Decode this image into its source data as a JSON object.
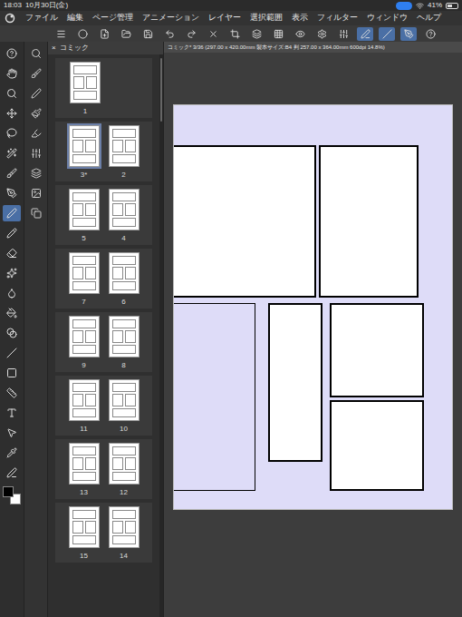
{
  "status_bar": {
    "time": "18:03",
    "date": "10月30日(金)",
    "battery": "41%"
  },
  "menu": {
    "items": [
      "ファイル",
      "編集",
      "ページ管理",
      "アニメーション",
      "レイヤー",
      "選択範囲",
      "表示",
      "フィルター",
      "ウィンドウ",
      "ヘルプ"
    ]
  },
  "command_bar": {
    "toggles": [
      {
        "on": false
      },
      {
        "on": false
      },
      {
        "on": false
      },
      {
        "on": false
      },
      {
        "on": false
      },
      {
        "on": false
      },
      {
        "on": false
      },
      {
        "on": false
      },
      {
        "on": false
      },
      {
        "on": false
      },
      {
        "on": false
      },
      {
        "on": false
      },
      {
        "on": false
      },
      {
        "on": false
      },
      {
        "on": true
      },
      {
        "on": true
      },
      {
        "on": true
      },
      {
        "on": false
      }
    ]
  },
  "tools": [
    {
      "selected": false
    },
    {
      "selected": false
    },
    {
      "selected": false
    },
    {
      "selected": false
    },
    {
      "selected": false
    },
    {
      "selected": false
    },
    {
      "selected": false
    },
    {
      "selected": false
    },
    {
      "selected": true
    },
    {
      "selected": false
    },
    {
      "selected": false
    },
    {
      "selected": false
    },
    {
      "selected": false
    },
    {
      "selected": false
    },
    {
      "selected": false
    },
    {
      "selected": false
    },
    {
      "selected": false
    },
    {
      "selected": false
    },
    {
      "selected": false
    },
    {
      "selected": false
    },
    {
      "selected": false
    },
    {
      "selected": false
    }
  ],
  "sub_tools": [
    {
      "selected": false
    },
    {
      "selected": false
    },
    {
      "selected": false
    },
    {
      "selected": false
    },
    {
      "selected": false
    },
    {
      "selected": false
    },
    {
      "selected": false
    },
    {
      "selected": false
    },
    {
      "selected": false
    }
  ],
  "colors": {
    "main": "#000000",
    "sub": "#ffffff"
  },
  "page_panel": {
    "tab": "コミック",
    "close": "×",
    "rows": [
      [
        {
          "label": "1",
          "selected": false
        }
      ],
      [
        {
          "label": "3*",
          "selected": true
        },
        {
          "label": "2",
          "selected": false
        }
      ],
      [
        {
          "label": "5",
          "selected": false
        },
        {
          "label": "4",
          "selected": false
        }
      ],
      [
        {
          "label": "7",
          "selected": false
        },
        {
          "label": "6",
          "selected": false
        }
      ],
      [
        {
          "label": "9",
          "selected": false
        },
        {
          "label": "8",
          "selected": false
        }
      ],
      [
        {
          "label": "11",
          "selected": false
        },
        {
          "label": "10",
          "selected": false
        }
      ],
      [
        {
          "label": "13",
          "selected": false
        },
        {
          "label": "12",
          "selected": false
        }
      ],
      [
        {
          "label": "15",
          "selected": false
        },
        {
          "label": "14",
          "selected": false
        }
      ]
    ]
  },
  "canvas": {
    "tab": "コミック* 3/36 (297.00 x 420.00mm 製本サイズ:B4 判 257.00 x 364.00mm 600dpi 14.8%)"
  }
}
